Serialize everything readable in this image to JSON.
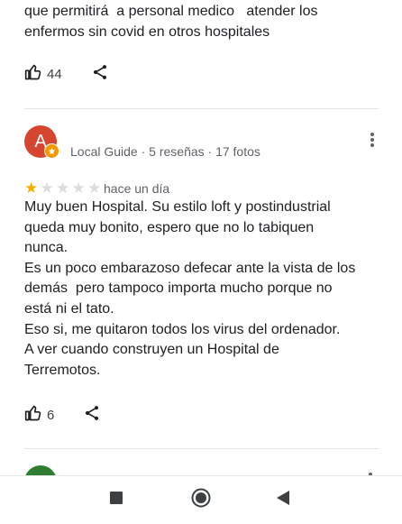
{
  "review_prev": {
    "text": "que permitirá  a personal medico   atender los\nenfermos sin covid en otros hospitales",
    "likes": "44"
  },
  "review": {
    "avatar_letter": "A",
    "meta": "Local Guide · 5 reseñas · 17 fotos",
    "rating": 1,
    "rating_max": 5,
    "date": "hace un día",
    "text": "Muy buen Hospital. Su estilo loft y postindustrial\nqueda muy bonito, espero que no lo tabiquen\nnunca.\nEs un poco embarazoso defecar ante la vista de los\ndemás  pero tampoco importa mucho porque no\nestá ni el tato.\nEso si, me quitaron todos los virus del ordenador.\nA ver cuando construyen un Hospital de\nTerremotos.",
    "likes": "6"
  },
  "colors": {
    "star_filled": "#f9ab00",
    "star_empty": "#dadce0",
    "avatar_bg": "#d5452f",
    "guide_badge": "#f29900"
  },
  "icons": [
    "thumbs-up-icon",
    "share-icon",
    "more-vert-icon",
    "local-guide-badge-icon",
    "square-icon",
    "circle-icon",
    "back-triangle-icon"
  ]
}
